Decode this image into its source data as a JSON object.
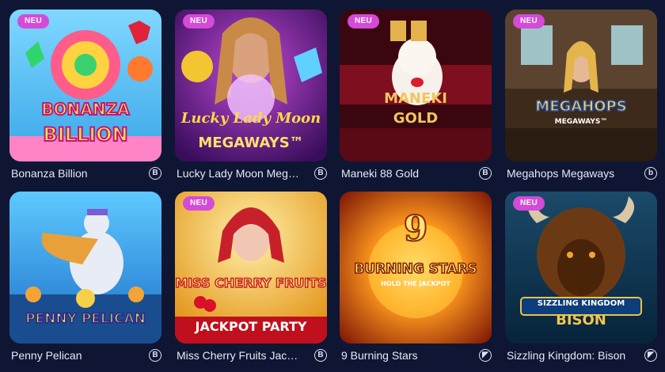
{
  "games": [
    {
      "title": "Bonanza Billion",
      "badge": "NEU",
      "provider_icon": "provider-b-icon",
      "provider_glyph": "B",
      "logo_line1": "BONANZA",
      "logo_line2": "BILLION"
    },
    {
      "title": "Lucky Lady Moon Mega...",
      "badge": "NEU",
      "provider_icon": "provider-b-icon",
      "provider_glyph": "B",
      "logo_line1": "Lucky Lady Moon",
      "logo_line2": "MEGAWAYS™"
    },
    {
      "title": "Maneki 88 Gold",
      "badge": "NEU",
      "provider_icon": "provider-b-icon",
      "provider_glyph": "B",
      "logo_line1": "MANEKI",
      "logo_line2": "GOLD"
    },
    {
      "title": "Megahops Megaways",
      "badge": "NEU",
      "provider_icon": "provider-b-lower-icon",
      "provider_glyph": "b",
      "logo_line1": "MEGAHOPS",
      "logo_line2": "MEGAWAYS™"
    },
    {
      "title": "Penny Pelican",
      "badge": "",
      "provider_icon": "provider-b-icon",
      "provider_glyph": "B",
      "logo_line1": "PENNY PELICAN",
      "logo_line2": ""
    },
    {
      "title": "Miss Cherry Fruits Jackp...",
      "badge": "NEU",
      "provider_icon": "provider-b-icon",
      "provider_glyph": "B",
      "logo_line1": "MISS CHERRY FRUITS",
      "logo_line2": "JACKPOT PARTY"
    },
    {
      "title": "9 Burning Stars",
      "badge": "",
      "provider_icon": "provider-arrow-icon",
      "provider_glyph": "◤",
      "logo_line1": "BURNING STARS",
      "logo_line2": "HOLD THE JACKPOT"
    },
    {
      "title": "Sizzling Kingdom: Bison",
      "badge": "NEU",
      "provider_icon": "provider-arrow-icon",
      "provider_glyph": "◤",
      "logo_line1": "SIZZLING KINGDOM",
      "logo_line2": "BISON"
    }
  ],
  "colors": {
    "background": "#0f1633",
    "badge": "#d44ad9",
    "text": "#e6e9f5"
  }
}
